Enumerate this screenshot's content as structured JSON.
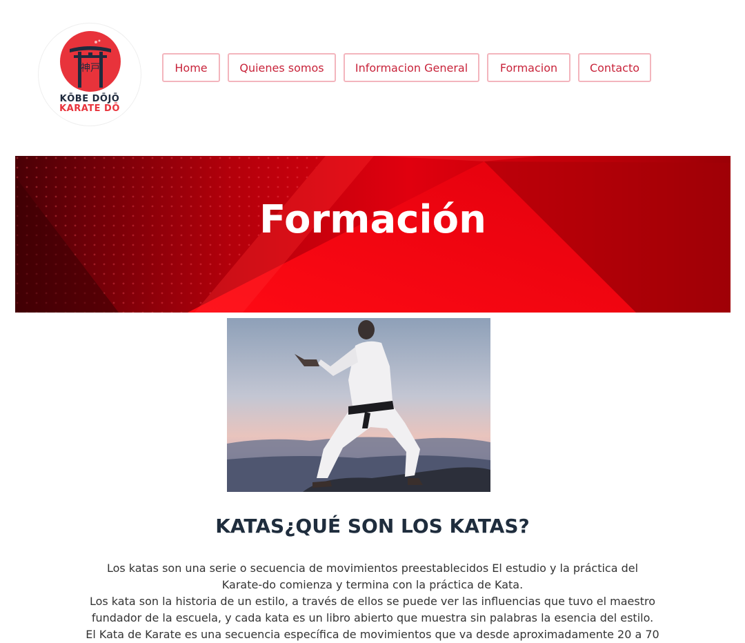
{
  "logo": {
    "kanji": "神戸",
    "line1": "KŌBE DŌJŌ",
    "line2": "KARATE DŌ",
    "icon": "torii-gate-icon",
    "colors": {
      "accent": "#e8333b",
      "dark": "#1f2a3d"
    }
  },
  "nav": {
    "items": [
      {
        "label": "Home"
      },
      {
        "label": "Quienes somos"
      },
      {
        "label": "Informacion General"
      },
      {
        "label": "Formacion"
      },
      {
        "label": "Contacto"
      }
    ]
  },
  "banner": {
    "title": "Formación"
  },
  "photo": {
    "subject": "karate-practitioner-image"
  },
  "article": {
    "heading": "KATAS¿QUÉ SON LOS KATAS?",
    "lines": [
      "Los katas son una serie o secuencia de movimientos preestablecidos El estudio y la práctica del",
      "Karate-do comienza y termina con la práctica de Kata.",
      "Los kata son la historia de un estilo, a través de ellos se puede ver las influencias que tuvo el maestro",
      "fundador de la escuela, y cada kata es un libro abierto que muestra sin palabras la esencia del estilo.",
      "El Kata de Karate es una secuencia específica de movimientos que va desde aproximadamente 20 a 70"
    ]
  },
  "colors": {
    "nav_border": "#f3b5bd",
    "nav_text": "#c8233a",
    "banner_red": "#e0000e",
    "heading": "#1f2d3d"
  }
}
